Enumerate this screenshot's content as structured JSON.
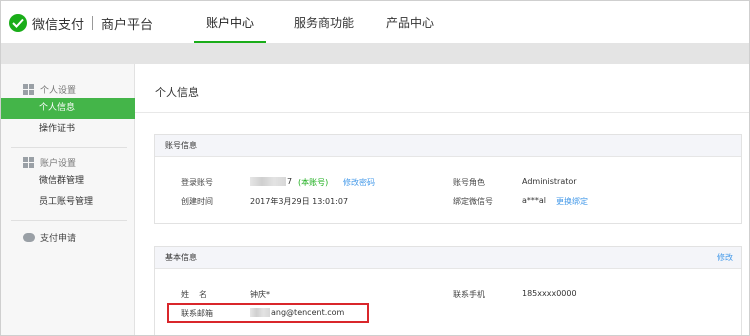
{
  "header": {
    "brand": "微信支付",
    "subtitle": "商户平台",
    "nav": [
      {
        "label": "账户中心",
        "active": true
      },
      {
        "label": "服务商功能",
        "active": false
      },
      {
        "label": "产品中心",
        "active": false
      }
    ]
  },
  "sidebar": {
    "group1": {
      "title": "个人设置",
      "items": [
        "个人信息",
        "操作证书"
      ],
      "active_index": 0
    },
    "group2": {
      "title": "账户设置",
      "items": [
        "微信群管理",
        "员工账号管理"
      ]
    },
    "pay_apply": "支付申请"
  },
  "main": {
    "title": "个人信息",
    "account": {
      "heading": "账号信息",
      "login_label": "登录账号",
      "login_value_suffix": "7",
      "login_tag": "(本账号)",
      "change_password": "修改密码",
      "created_label": "创建时间",
      "created_value": "2017年3月29日 13:01:07",
      "role_label": "账号角色",
      "role_value": "Administrator",
      "wechat_label": "绑定微信号",
      "wechat_value": "a***al",
      "change_binding": "更换绑定"
    },
    "basic": {
      "heading": "基本信息",
      "edit": "修改",
      "name_label": "姓　名",
      "name_value": "钟庆*",
      "phone_label": "联系手机",
      "phone_value": "185xxxx0000",
      "email_label": "联系邮箱",
      "email_value": "ang@tencent.com"
    }
  },
  "colors": {
    "brand_green": "#1aad19",
    "sidebar_active": "#44b549",
    "link": "#459ae9",
    "highlight": "#d9262b"
  }
}
